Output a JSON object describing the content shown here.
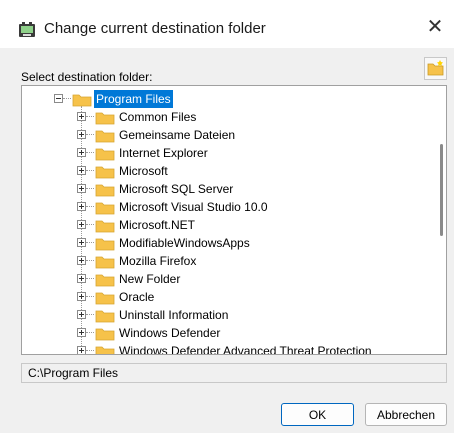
{
  "window": {
    "title": "Change current destination folder",
    "close_glyph": "✕"
  },
  "dialog": {
    "select_label": "Select destination folder:",
    "path_value": "C:\\Program Files",
    "ok_label": "OK",
    "cancel_label": "Abbrechen"
  },
  "tree": {
    "root": {
      "label": "Program Files",
      "expanded": true,
      "selected": true
    },
    "children": [
      {
        "label": "Common Files"
      },
      {
        "label": "Gemeinsame Dateien"
      },
      {
        "label": "Internet Explorer"
      },
      {
        "label": "Microsoft"
      },
      {
        "label": "Microsoft SQL Server"
      },
      {
        "label": "Microsoft Visual Studio 10.0"
      },
      {
        "label": "Microsoft.NET"
      },
      {
        "label": "ModifiableWindowsApps"
      },
      {
        "label": "Mozilla Firefox"
      },
      {
        "label": "New Folder"
      },
      {
        "label": "Oracle"
      },
      {
        "label": "Uninstall Information"
      },
      {
        "label": "Windows Defender"
      },
      {
        "label": "Windows Defender Advanced Threat Protection"
      }
    ]
  },
  "icons": {
    "app": "app-icon",
    "new_folder": "new-folder-icon",
    "folder": "folder-icon"
  },
  "colors": {
    "selection": "#0078d7",
    "folder": "#f6c24a",
    "ok_border": "#0067c0"
  }
}
